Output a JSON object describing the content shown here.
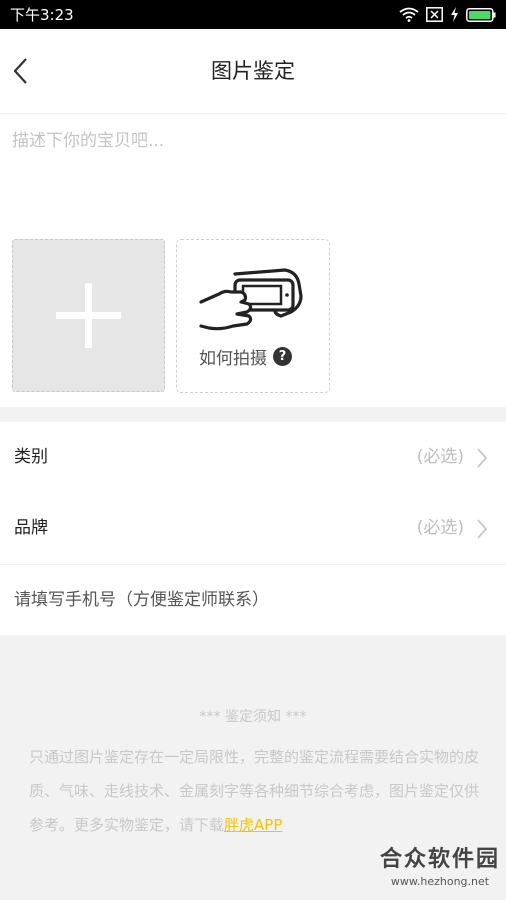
{
  "status_bar": {
    "time": "下午3:23",
    "icons": [
      "wifi-icon",
      "sim-x-icon",
      "charging-icon",
      "battery-icon"
    ]
  },
  "header": {
    "title": "图片鉴定",
    "back_icon": "chevron-left-icon"
  },
  "description": {
    "placeholder": "描述下你的宝贝吧..."
  },
  "photos": {
    "add_icon": "plus-icon",
    "how_to_label": "如何拍摄",
    "how_to_badge": "?",
    "how_to_icon": "hands-holding-phone-icon"
  },
  "form": {
    "category": {
      "label": "类别",
      "hint": "(必选)"
    },
    "brand": {
      "label": "品牌",
      "hint": "(必选)"
    },
    "phone": {
      "placeholder": "请填写手机号（方便鉴定师联系）"
    }
  },
  "notice": {
    "title": "*** 鉴定须知 ***",
    "body": "只通过图片鉴定存在一定局限性，完整的鉴定流程需要结合实物的皮质、气味、走线技术、金属刻字等各种细节综合考虑，图片鉴定仅供参考。更多实物鉴定，请下载",
    "link_text": "胖虎APP"
  },
  "watermark": {
    "main": "合众软件园",
    "sub": "www.hezhong.net"
  },
  "colors": {
    "accent": "#f4c400",
    "background": "#f2f2f2",
    "hint": "#bdbdbd"
  }
}
